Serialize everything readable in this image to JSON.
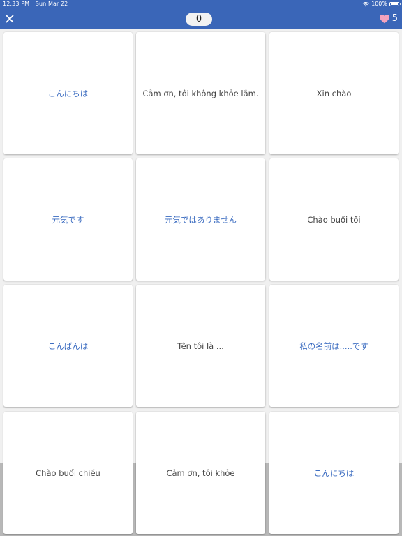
{
  "status_bar": {
    "time": "12:33 PM",
    "date": "Sun Mar 22",
    "battery": "100%",
    "icons": [
      "wifi-icon",
      "battery-icon"
    ]
  },
  "header": {
    "close_icon": "close-icon",
    "score": "0",
    "lives": "5",
    "lives_icon": "heart-icon"
  },
  "colors": {
    "header": "#3a66b8",
    "japanese_text": "#3a6bc0",
    "vietnamese_text": "#444444",
    "heart": "#f4a3bd"
  },
  "cards": [
    {
      "text": "こんにちは",
      "lang": "jp"
    },
    {
      "text": "Cảm ơn, tôi không khỏe lắm.",
      "lang": "vi"
    },
    {
      "text": "Xin chào",
      "lang": "vi"
    },
    {
      "text": "元気です",
      "lang": "jp"
    },
    {
      "text": "元気ではありません",
      "lang": "jp"
    },
    {
      "text": "Chào buổi tối",
      "lang": "vi"
    },
    {
      "text": "こんばんは",
      "lang": "jp"
    },
    {
      "text": "Tên tôi là ...",
      "lang": "vi"
    },
    {
      "text": "私の名前は.....です",
      "lang": "jp"
    },
    {
      "text": "Chào buổi chiều",
      "lang": "vi"
    },
    {
      "text": "Cảm ơn, tôi khỏe",
      "lang": "vi"
    },
    {
      "text": "こんにちは",
      "lang": "jp"
    }
  ]
}
